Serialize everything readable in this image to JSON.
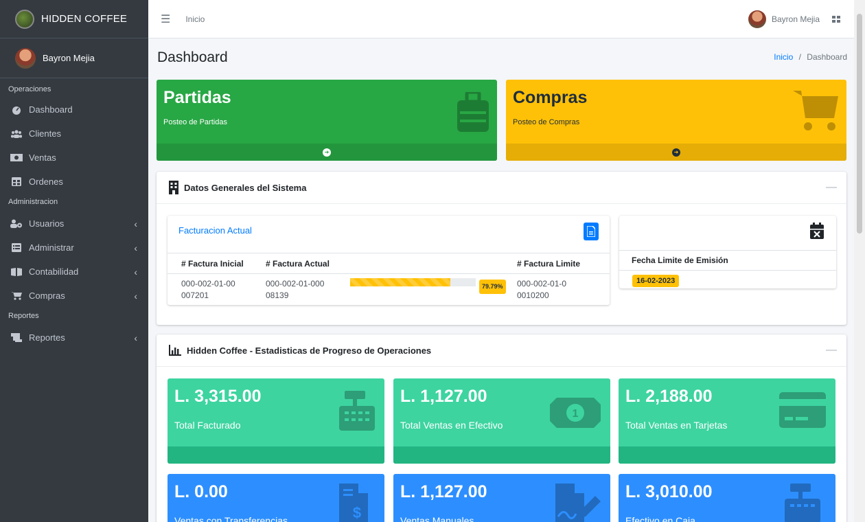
{
  "brand": {
    "name": "HIDDEN COFFEE"
  },
  "user": {
    "name": "Bayron Mejia"
  },
  "sidebar": {
    "sections": [
      {
        "header": "Operaciones",
        "items": [
          {
            "label": "Dashboard",
            "icon": "dashboard-icon"
          },
          {
            "label": "Clientes",
            "icon": "users-icon"
          },
          {
            "label": "Ventas",
            "icon": "money-icon"
          },
          {
            "label": "Ordenes",
            "icon": "table-icon"
          }
        ]
      },
      {
        "header": "Administracion",
        "items": [
          {
            "label": "Usuarios",
            "icon": "user-cog-icon",
            "expandable": true
          },
          {
            "label": "Administrar",
            "icon": "list-icon",
            "expandable": true
          },
          {
            "label": "Contabilidad",
            "icon": "book-icon",
            "expandable": true
          },
          {
            "label": "Compras",
            "icon": "cart-icon",
            "expandable": true
          }
        ]
      },
      {
        "header": "Reportes",
        "items": [
          {
            "label": "Reportes",
            "icon": "scroll-icon",
            "expandable": true
          }
        ]
      }
    ]
  },
  "topbar": {
    "link": "Inicio",
    "user": "Bayron Mejia"
  },
  "page": {
    "title": "Dashboard",
    "breadcrumb": {
      "home": "Inicio",
      "sep": "/",
      "current": "Dashboard"
    }
  },
  "boxes": [
    {
      "title": "Partidas",
      "subtitle": "Posteo de Partidas",
      "color": "#28a745"
    },
    {
      "title": "Compras",
      "subtitle": "Posteo de Compras",
      "color": "#ffc107"
    }
  ],
  "datos": {
    "title": "Datos Generales del Sistema",
    "facturacion": {
      "title": "Facturacion Actual",
      "headers": [
        "# Factura Inicial",
        "# Factura Actual",
        "",
        "# Factura Limite"
      ],
      "inicial": "000-002-01-00007201",
      "actual": "000-002-01-00008139",
      "progress": 79.79,
      "progress_label": "79.79%",
      "limite": "000-002-01-00010200"
    },
    "fecha": {
      "header": "Fecha Limite de Emisión",
      "value": "16-02-2023"
    }
  },
  "stats": {
    "title": "Hidden Coffee - Estadisticas de Progreso de Operaciones",
    "items": [
      {
        "value": "L. 3,315.00",
        "label": "Total Facturado",
        "icon": "cash-register-icon",
        "color": "#3dd4a0"
      },
      {
        "value": "L. 1,127.00",
        "label": "Total Ventas en Efectivo",
        "icon": "money-bill-icon",
        "color": "#3dd4a0"
      },
      {
        "value": "L. 2,188.00",
        "label": "Total Ventas en Tarjetas",
        "icon": "credit-card-icon",
        "color": "#3dd4a0"
      },
      {
        "value": "L. 0.00",
        "label": "Ventas con Transferencias",
        "icon": "invoice-dollar-icon",
        "color": "#2d8fff"
      },
      {
        "value": "L. 1,127.00",
        "label": "Ventas Manuales",
        "icon": "file-signature-icon",
        "color": "#2d8fff"
      },
      {
        "value": "L. 3,010.00",
        "label": "Efectivo en Caja",
        "icon": "cash-register-icon",
        "color": "#2d8fff"
      }
    ]
  }
}
